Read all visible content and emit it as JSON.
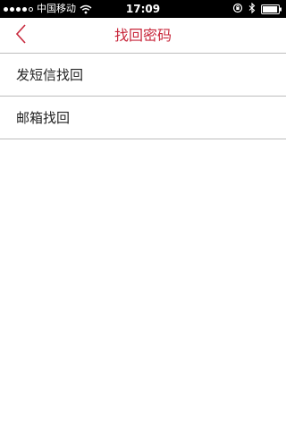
{
  "status_bar": {
    "carrier": "中国移动",
    "time": "17:09",
    "signal_bars_filled": 4,
    "signal_bars_total": 5,
    "battery_level": 0.95
  },
  "nav": {
    "title": "找回密码",
    "back_icon": "chevron-left-icon",
    "accent_color": "#c8283c"
  },
  "menu": {
    "items": [
      {
        "label": "发短信找回"
      },
      {
        "label": "邮箱找回"
      }
    ]
  }
}
